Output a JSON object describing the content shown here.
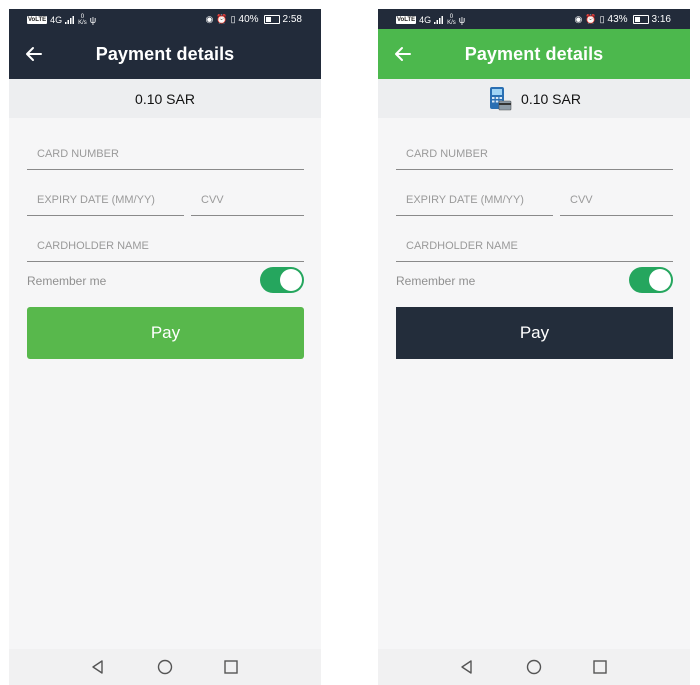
{
  "screens": [
    {
      "status": {
        "network": "4G",
        "speed_value": "0",
        "speed_unit": "K/s",
        "battery": "40%",
        "time": "2:58"
      },
      "header": {
        "title": "Payment details",
        "color": "#222b3a"
      },
      "amount": "0.10 SAR",
      "fields": {
        "card_number_placeholder": "CARD NUMBER",
        "expiry_placeholder": "EXPIRY DATE (MM/YY)",
        "cvv_placeholder": "CVV",
        "cardholder_placeholder": "CARDHOLDER NAME"
      },
      "remember_label": "Remember me",
      "remember_on": true,
      "pay_label": "Pay",
      "pay_color": "#58b84c",
      "has_payment_icon": false
    },
    {
      "status": {
        "network": "4G",
        "speed_value": "0",
        "speed_unit": "K/s",
        "battery": "43%",
        "time": "3:16"
      },
      "header": {
        "title": "Payment details",
        "color": "#4cb84d"
      },
      "amount": "0.10 SAR",
      "fields": {
        "card_number_placeholder": "CARD NUMBER",
        "expiry_placeholder": "EXPIRY DATE (MM/YY)",
        "cvv_placeholder": "CVV",
        "cardholder_placeholder": "CARDHOLDER NAME"
      },
      "remember_label": "Remember me",
      "remember_on": true,
      "pay_label": "Pay",
      "pay_color": "#232d3b",
      "has_payment_icon": true,
      "payment_icon": "card-terminal-icon"
    }
  ]
}
